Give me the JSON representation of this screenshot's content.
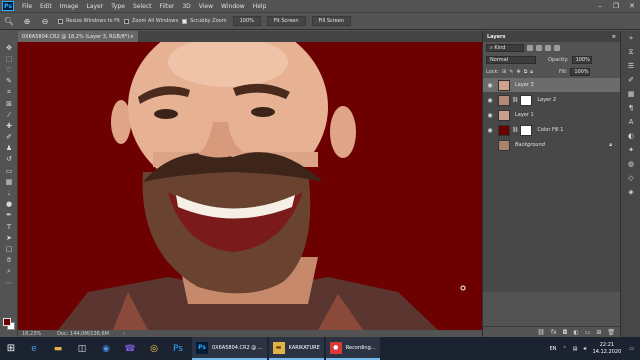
{
  "menu": {
    "items": [
      "File",
      "Edit",
      "Image",
      "Layer",
      "Type",
      "Select",
      "Filter",
      "3D",
      "View",
      "Window",
      "Help"
    ],
    "app_logo": "Ps"
  },
  "options": {
    "resize_windows": "Resize Windows to Fit",
    "zoom_all": "Zoom All Windows",
    "scrubby_zoom": "Scrubby Zoom",
    "zoom_100": "100%",
    "fit_screen": "Fit Screen",
    "fill_screen": "Fill Screen"
  },
  "document": {
    "tab_title": "0X6A5804.CR2 @ 18,2% (Layer 3, RGB/8*)",
    "close": "×"
  },
  "status": {
    "zoom": "18,23%",
    "doc": "Doc: 144,0M/136,6M"
  },
  "layers": {
    "panel_title": "Layers",
    "filter": "Kind",
    "blend_mode": "Normal",
    "opacity_label": "Opacity:",
    "opacity_value": "100%",
    "lock_label": "Lock:",
    "fill_label": "Fill:",
    "fill_value": "100%",
    "items": [
      {
        "name": "Layer 3",
        "selected": true
      },
      {
        "name": "Layer 2",
        "selected": false
      },
      {
        "name": "Layer 1",
        "selected": false
      },
      {
        "name": "Color Fill 1",
        "selected": false
      },
      {
        "name": "Background",
        "selected": false
      }
    ]
  },
  "taskbar": {
    "windows": [
      {
        "label": "0X6A5804.CR2 @ ..."
      },
      {
        "label": "KARIKATURE"
      },
      {
        "label": "Recording..."
      }
    ],
    "lang": "EN",
    "time": "22:21",
    "date": "14.12.2020"
  },
  "colors": {
    "canvas_bg": "#6d0000",
    "fg_swatch": "#6b0000",
    "bg_swatch": "#ffffff",
    "taskbar": "#1b2230"
  }
}
